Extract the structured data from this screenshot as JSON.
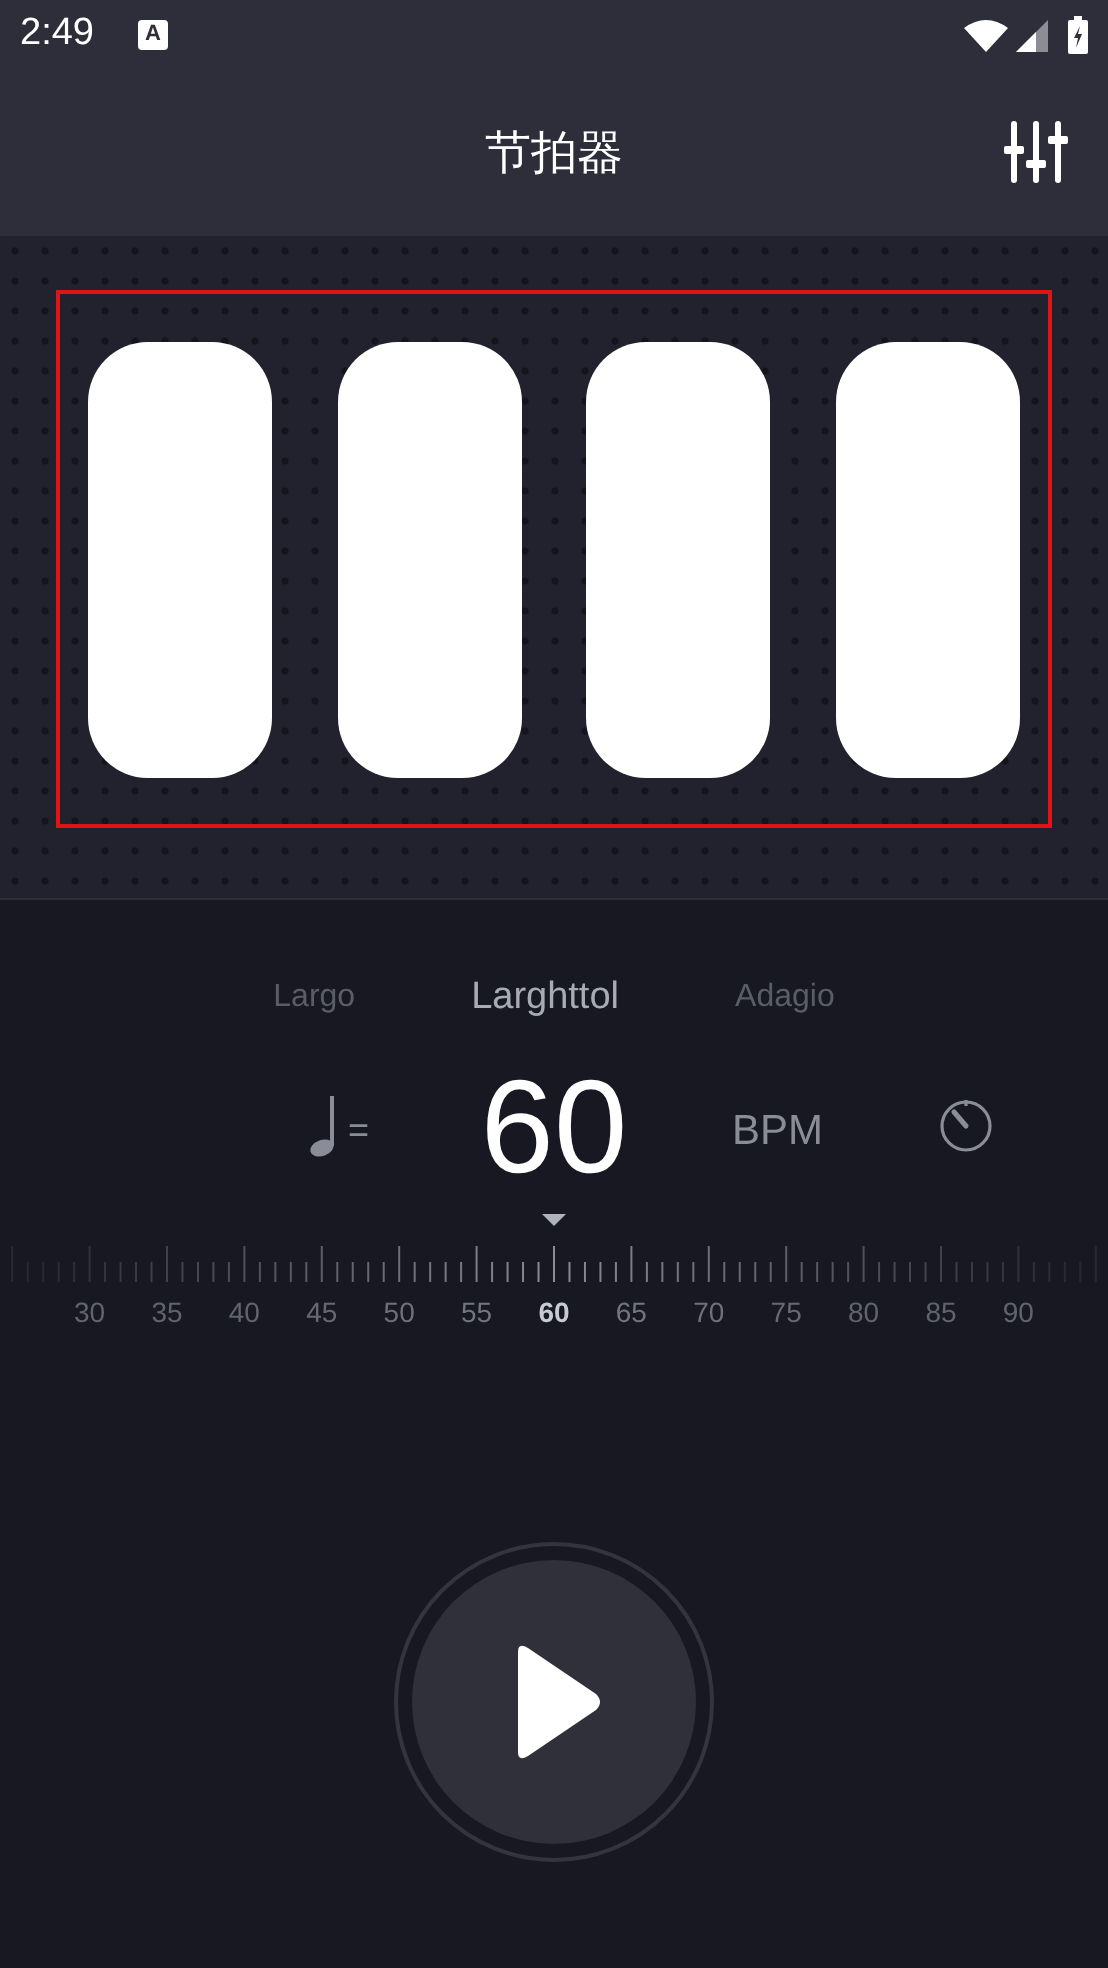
{
  "status_bar": {
    "time": "2:49",
    "keyboard_badge": "A"
  },
  "header": {
    "title": "节拍器"
  },
  "beats": [
    {
      "lit": true
    },
    {
      "lit": true
    },
    {
      "lit": true
    },
    {
      "lit": true
    }
  ],
  "tempo_names": [
    {
      "label": "Largo",
      "selected": false
    },
    {
      "label": "Larghttol",
      "selected": true
    },
    {
      "label": "Adagio",
      "selected": false
    }
  ],
  "tempo": {
    "equals": "=",
    "bpm": "60",
    "unit": "BPM"
  },
  "ruler": {
    "labels": [
      {
        "label": "30",
        "selected": false
      },
      {
        "label": "35",
        "selected": false
      },
      {
        "label": "40",
        "selected": false
      },
      {
        "label": "45",
        "selected": false
      },
      {
        "label": "50",
        "selected": false
      },
      {
        "label": "55",
        "selected": false
      },
      {
        "label": "60",
        "selected": true
      },
      {
        "label": "65",
        "selected": false
      },
      {
        "label": "70",
        "selected": false
      },
      {
        "label": "75",
        "selected": false
      },
      {
        "label": "80",
        "selected": false
      },
      {
        "label": "85",
        "selected": false
      },
      {
        "label": "90",
        "selected": false
      }
    ]
  },
  "play_button": {
    "playing": false
  }
}
